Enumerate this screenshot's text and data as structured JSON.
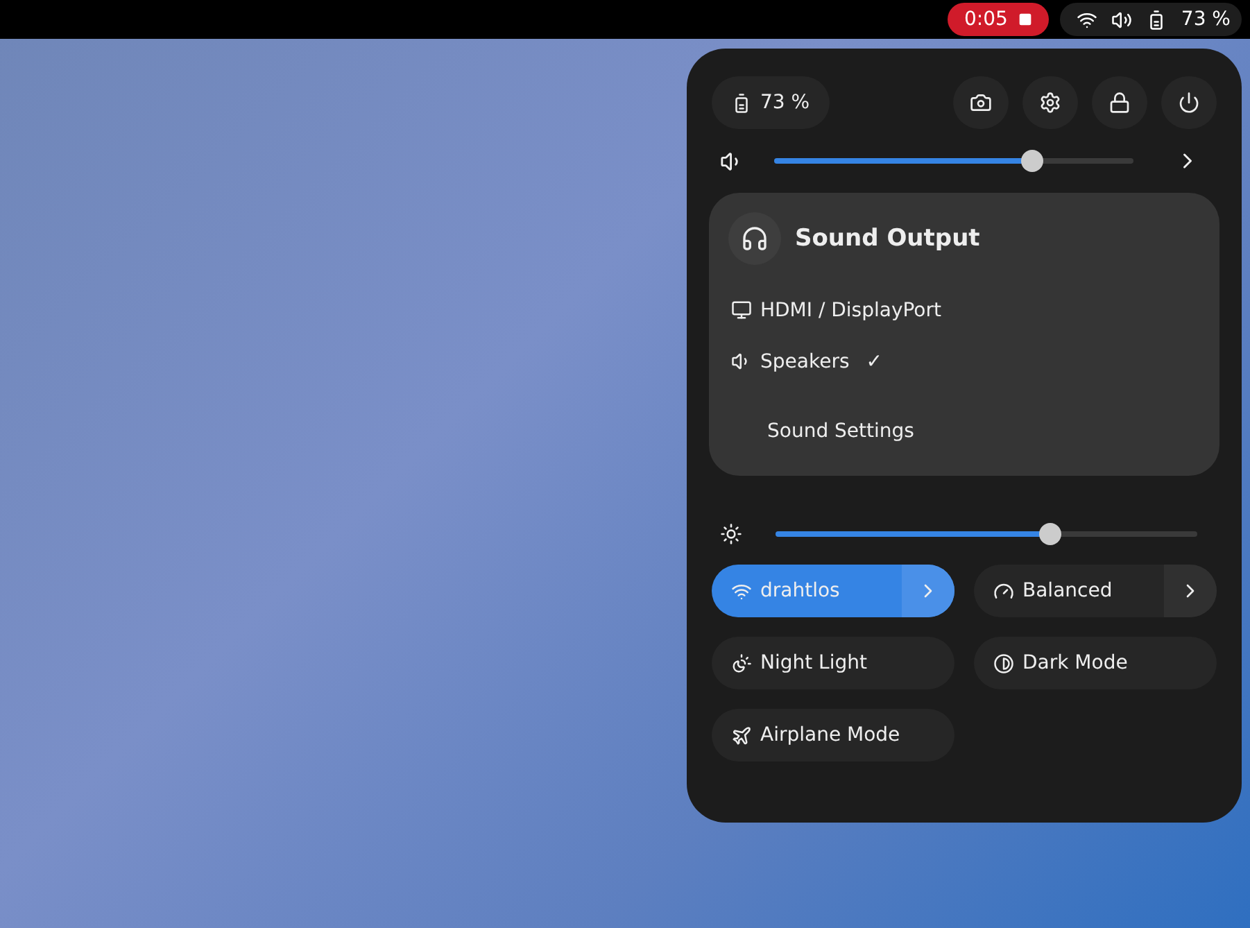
{
  "top_bar": {
    "recording": {
      "time": "0:05"
    },
    "battery": "73 %"
  },
  "quick_settings": {
    "battery": "73 %",
    "volume": {
      "level": 0.72,
      "expanded": true
    },
    "sound_output": {
      "title": "Sound Output",
      "devices": [
        {
          "kind": "monitor",
          "label": "HDMI / DisplayPort",
          "selected": false
        },
        {
          "kind": "speaker",
          "label": "Speakers",
          "selected": true
        }
      ],
      "check_mark": "✓",
      "settings_link": "Sound Settings"
    },
    "brightness": {
      "level": 0.65
    },
    "toggles": [
      {
        "kind": "wifi",
        "label": "drahtlos",
        "on": true,
        "has_menu": true
      },
      {
        "kind": "power",
        "label": "Balanced",
        "on": false,
        "has_menu": true
      },
      {
        "kind": "night",
        "label": "Night Light",
        "on": false,
        "has_menu": false
      },
      {
        "kind": "dark",
        "label": "Dark Mode",
        "on": false,
        "has_menu": false
      },
      {
        "kind": "airplane",
        "label": "Airplane Mode",
        "on": false,
        "has_menu": false
      }
    ]
  }
}
